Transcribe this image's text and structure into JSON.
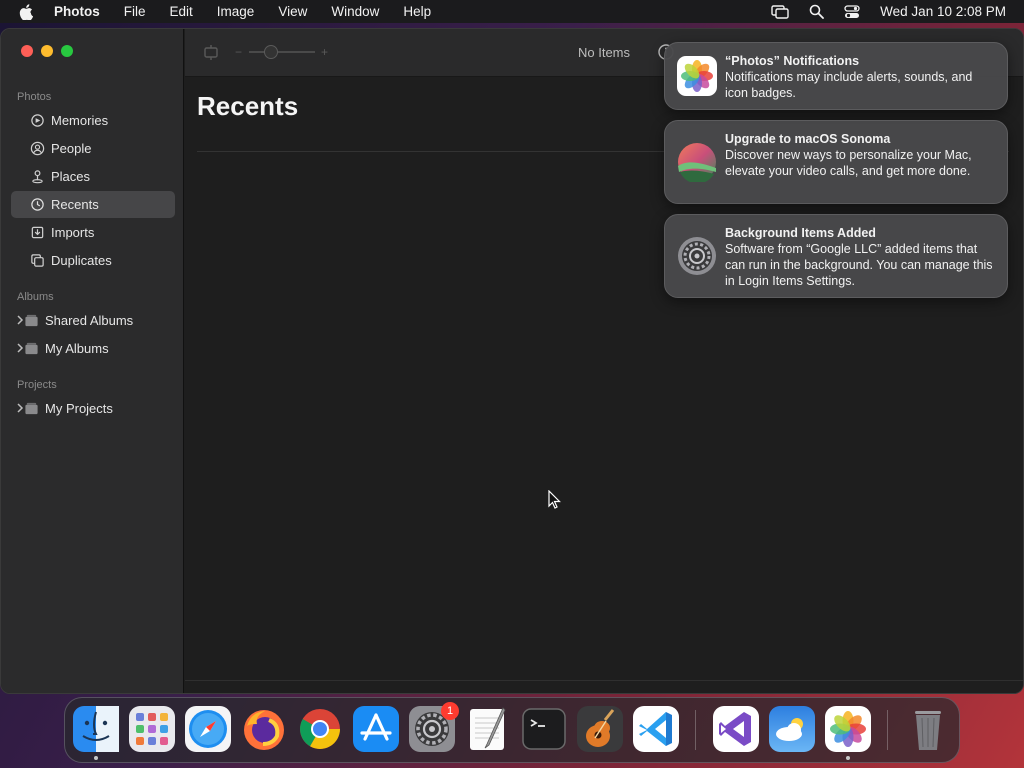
{
  "menubar": {
    "app_name": "Photos",
    "items": [
      "File",
      "Edit",
      "Image",
      "View",
      "Window",
      "Help"
    ],
    "clock": "Wed Jan 10  2:08 PM"
  },
  "sidebar": {
    "section_photos": "Photos",
    "items": [
      {
        "label": "Memories",
        "icon": "memories-icon"
      },
      {
        "label": "People",
        "icon": "people-icon"
      },
      {
        "label": "Places",
        "icon": "places-icon"
      },
      {
        "label": "Recents",
        "icon": "recents-icon",
        "selected": true
      },
      {
        "label": "Imports",
        "icon": "imports-icon"
      },
      {
        "label": "Duplicates",
        "icon": "duplicates-icon"
      }
    ],
    "section_albums": "Albums",
    "albums": [
      {
        "label": "Shared Albums",
        "icon": "shared-albums-icon"
      },
      {
        "label": "My Albums",
        "icon": "folder-icon"
      }
    ],
    "section_projects": "Projects",
    "projects": [
      {
        "label": "My Projects",
        "icon": "folder-icon"
      }
    ]
  },
  "toolbar": {
    "zoom_minus": "−",
    "zoom_plus": "+",
    "status": "No Items"
  },
  "main": {
    "title": "Recents"
  },
  "notifications": [
    {
      "icon": "photos-app-icon",
      "title": "“Photos” Notifications",
      "body": "Notifications may include alerts, sounds, and icon badges."
    },
    {
      "icon": "macos-sonoma-icon",
      "title": "Upgrade to macOS Sonoma",
      "body": "Discover new ways to personalize your Mac, elevate your video calls, and get more done."
    },
    {
      "icon": "system-settings-icon",
      "title": "Background Items Added",
      "body": "Software from “Google LLC” added items that can run in the background. You can manage this in Login Items Settings."
    }
  ],
  "dock": {
    "apps": [
      "Finder",
      "Launchpad",
      "Safari",
      "Firefox",
      "Chrome",
      "App Store",
      "System Settings",
      "TextEdit",
      "Terminal",
      "GarageBand",
      "Visual Studio Code",
      "Visual Studio",
      "Weather",
      "Photos",
      "Trash"
    ],
    "settings_badge": "1"
  }
}
